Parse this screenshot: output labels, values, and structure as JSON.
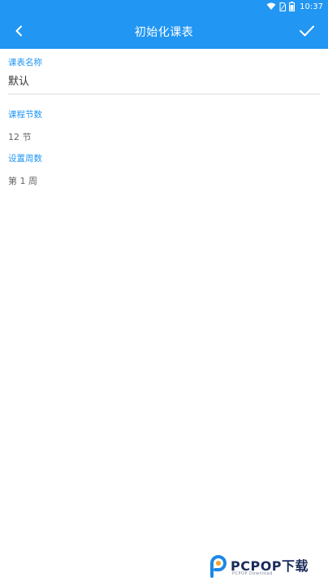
{
  "status": {
    "time": "10:37",
    "icons": [
      "wifi-icon",
      "sim-icon",
      "battery-icon"
    ]
  },
  "appbar": {
    "title": "初始化课表",
    "back_icon": "chevron-left-icon",
    "confirm_icon": "check-icon"
  },
  "form": {
    "name_label": "课表名称",
    "name_value": "默认",
    "sections_label": "课程节数",
    "sections_value": "12 节",
    "week_label": "设置周数",
    "week_value": "第 1 周"
  },
  "watermark": {
    "brand": "PCPOP下载",
    "subtitle": "PCPOP Download"
  },
  "colors": {
    "primary": "#2196f3",
    "label": "#2196f3",
    "text": "#333333",
    "value": "#666666"
  }
}
